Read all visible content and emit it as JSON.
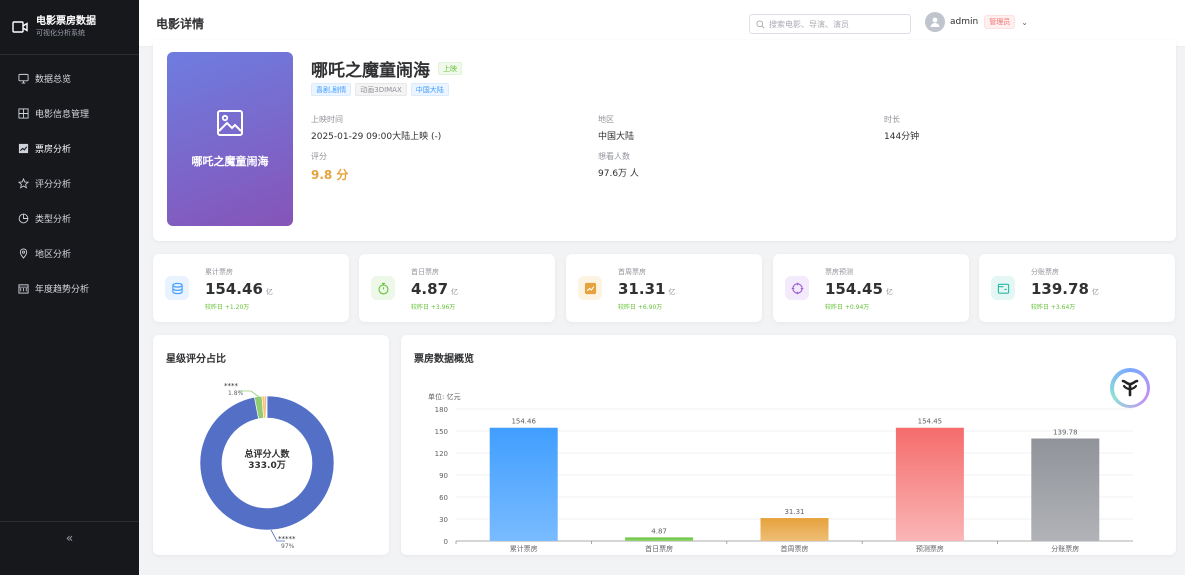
{
  "sidebar": {
    "brand_title": "电影票房数据",
    "brand_sub": "可视化分析系统",
    "items": [
      {
        "label": "数据总览",
        "icon": "monitor-icon"
      },
      {
        "label": "电影信息管理",
        "icon": "grid-icon"
      },
      {
        "label": "票房分析",
        "icon": "chart-icon"
      },
      {
        "label": "评分分析",
        "icon": "star-icon"
      },
      {
        "label": "类型分析",
        "icon": "pie-icon"
      },
      {
        "label": "地区分析",
        "icon": "location-icon"
      },
      {
        "label": "年度趋势分析",
        "icon": "calendar-icon"
      }
    ],
    "collapse_label": "«"
  },
  "header": {
    "title": "电影详情",
    "search_placeholder": "搜索电影、导演、演员",
    "username": "admin",
    "role": "管理员"
  },
  "movie": {
    "poster_title": "哪吒之魔童闹海",
    "name": "哪吒之魔童闹海",
    "status": "上映",
    "tags": [
      "喜剧,剧情",
      "动画3DIMAX",
      "中国大陆"
    ],
    "release_label": "上映时间",
    "release_value": "2025-01-29 09:00大陆上映 (-)",
    "region_label": "地区",
    "region_value": "中国大陆",
    "duration_label": "时长",
    "duration_value": "144分钟",
    "rating_label": "评分",
    "rating_value": "9.8 分",
    "viewers_label": "想看人数",
    "viewers_value": "97.6万 人"
  },
  "stats": [
    {
      "label": "累计票房",
      "value": "154.46",
      "unit": "亿",
      "change": "较昨日 +1.20万",
      "icon": "database-icon",
      "color": "#409eff",
      "bg": "#e8f3ff"
    },
    {
      "label": "首日票房",
      "value": "4.87",
      "unit": "亿",
      "change": "较昨日 +3.96万",
      "icon": "stopwatch-icon",
      "color": "#67c23a",
      "bg": "#eef8e8"
    },
    {
      "label": "首周票房",
      "value": "31.31",
      "unit": "亿",
      "change": "较昨日 +6.90万",
      "icon": "trend-icon",
      "color": "#e6a23c",
      "bg": "#fdf3e3"
    },
    {
      "label": "票房预测",
      "value": "154.45",
      "unit": "亿",
      "change": "较昨日 +0.94万",
      "icon": "target-icon",
      "color": "#9b59d0",
      "bg": "#f3ebfb"
    },
    {
      "label": "分账票房",
      "value": "139.78",
      "unit": "亿",
      "change": "较昨日 +3.64万",
      "icon": "split-icon",
      "color": "#2bb8a6",
      "bg": "#e5f7f4"
    }
  ],
  "pie": {
    "title": "星级评分占比",
    "center_label": "总评分人数",
    "center_value": "333.0万",
    "colors": [
      "#5470c6",
      "#91cc75",
      "#fac858",
      "#ee6666",
      "#73c0de"
    ]
  },
  "bar": {
    "title": "票房数据概览",
    "unit_label": "单位: 亿元",
    "colors": [
      [
        "#409eff",
        "#79bbff"
      ],
      [
        "#67c23a",
        "#95d475"
      ],
      [
        "#e6a23c",
        "#eebe77"
      ],
      [
        "#f56c6c",
        "#fab6b6"
      ],
      [
        "#909399",
        "#b1b3b8"
      ]
    ]
  },
  "chart_data": [
    {
      "type": "pie",
      "title": "星级评分占比",
      "categories": [
        "*****",
        "****",
        "***",
        "**",
        "*"
      ],
      "values": [
        97,
        1.8,
        0.7,
        0.3,
        0.2
      ],
      "labels": [
        {
          "name": "*****",
          "text": "97%"
        },
        {
          "name": "****",
          "text": "1.8%"
        }
      ]
    },
    {
      "type": "bar",
      "title": "票房数据概览",
      "ylabel": "单位: 亿元",
      "categories": [
        "累计票房",
        "首日票房",
        "首周票房",
        "预测票房",
        "分账票房"
      ],
      "values": [
        154.46,
        4.87,
        31.31,
        154.45,
        139.78
      ],
      "ylim": [
        0,
        180
      ],
      "yticks": [
        0,
        30,
        60,
        90,
        120,
        150,
        180
      ],
      "grid": true
    }
  ]
}
